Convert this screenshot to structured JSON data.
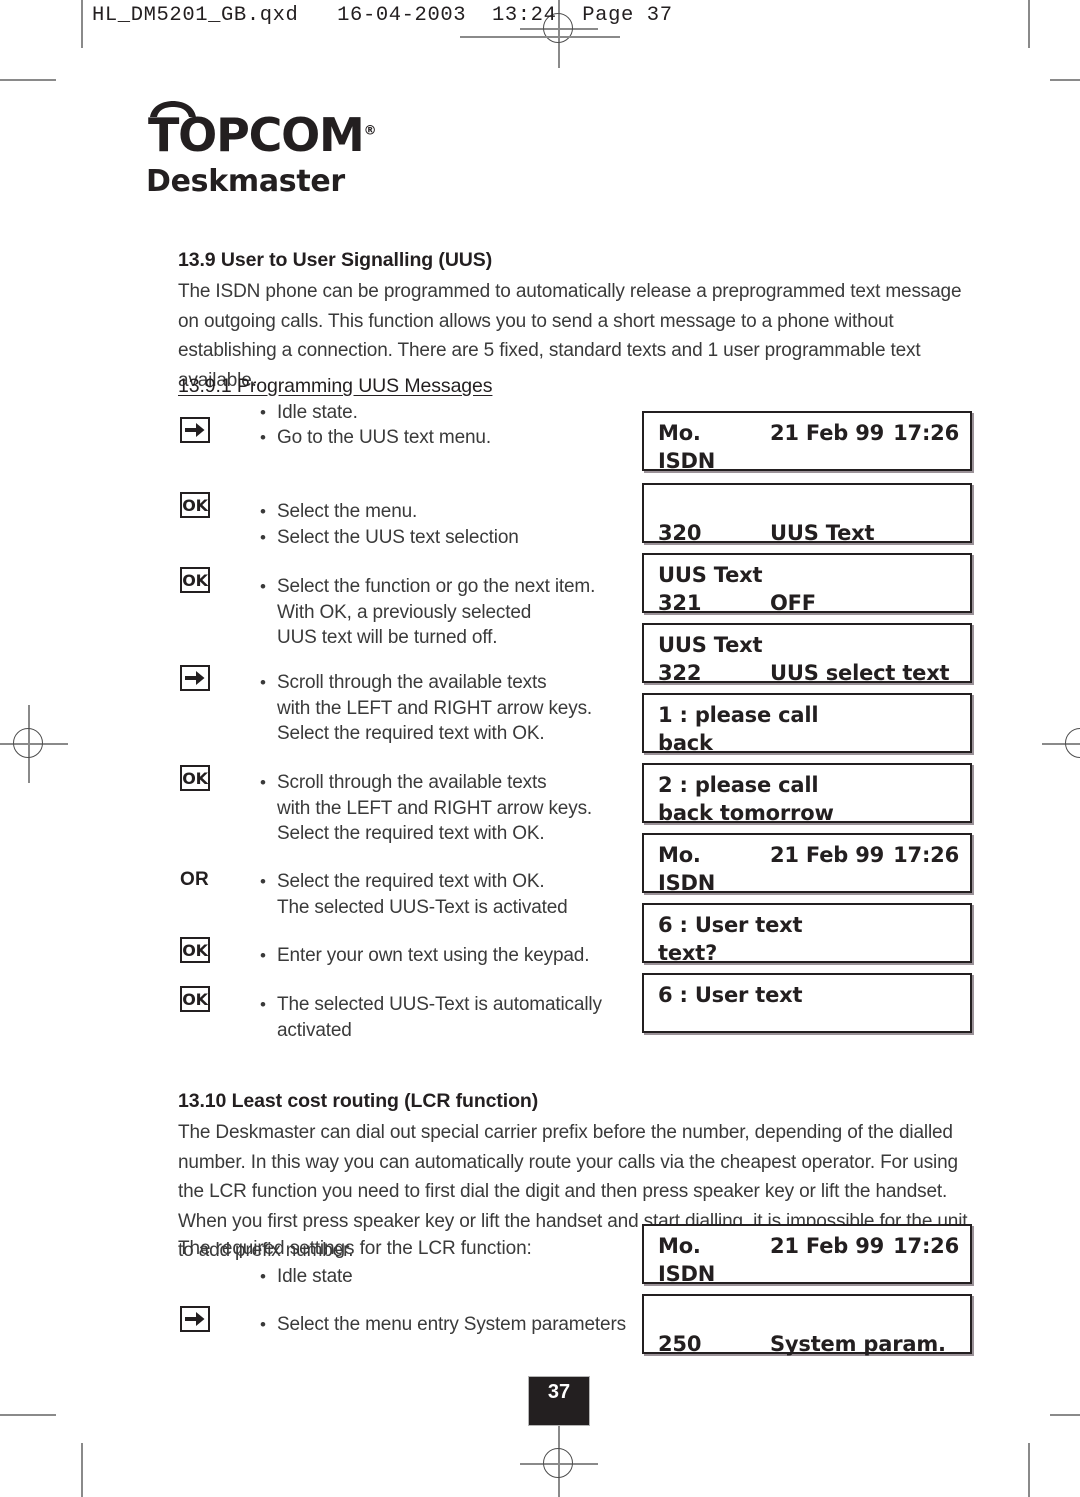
{
  "file_header": "HL_DM5201_GB.qxd   16-04-2003  13:24  Page 37",
  "logo": {
    "brand": "TOPCOM",
    "registered_mark": "®",
    "product": "Deskmaster"
  },
  "sections": {
    "uus": {
      "heading": "13.9 User to User Signalling (UUS)",
      "body": "The ISDN phone can be programmed to automatically release a preprogrammed text message on outgoing calls. This function allows you to send a short message to a phone without establishing a connection. There are 5 fixed, standard texts and 1 user programmable text available.",
      "subheading": "13.9.1 Programming UUS Messages"
    },
    "lcr": {
      "heading": "13.10 Least cost routing (LCR function)",
      "body": "The Deskmaster can dial out special carrier prefix before the number, depending of the dialled number. In this way you can automatically route your calls via the cheapest operator. For using the LCR function you need to first dial the digit and then press speaker key or lift the handset. When you first press speaker key or lift the handset and start dialling, it is impossible for the unit to add prefix number.",
      "settings_intro": "The required settings for the LCR function:"
    }
  },
  "uus_steps": [
    {
      "icon": "none",
      "lines": [
        {
          "bullet": true,
          "text": "Idle state."
        }
      ]
    },
    {
      "icon": "arrow-right",
      "lines": [
        {
          "bullet": true,
          "text": "Go to the UUS text menu."
        }
      ]
    },
    {
      "icon": "ok",
      "lines": [
        {
          "bullet": true,
          "text": "Select the menu."
        },
        {
          "bullet": true,
          "text": "Select the UUS text selection"
        }
      ]
    },
    {
      "icon": "ok",
      "lines": [
        {
          "bullet": true,
          "text": "Select the function or go the next item."
        },
        {
          "bullet": false,
          "text": "With OK, a previously selected"
        },
        {
          "bullet": false,
          "text": "UUS text will be turned off."
        }
      ]
    },
    {
      "icon": "arrow-right",
      "lines": [
        {
          "bullet": true,
          "text": "Scroll through the available texts"
        },
        {
          "bullet": false,
          "text": "with the LEFT and RIGHT arrow keys."
        },
        {
          "bullet": false,
          "text": "Select the required text with OK."
        }
      ]
    },
    {
      "icon": "ok",
      "lines": [
        {
          "bullet": true,
          "text": "Scroll through the available texts"
        },
        {
          "bullet": false,
          "text": "with the LEFT and RIGHT arrow keys."
        },
        {
          "bullet": false,
          "text": "Select the required text with OK."
        }
      ]
    },
    {
      "icon": "or",
      "icon_label": "OR",
      "lines": [
        {
          "bullet": true,
          "text": "Select the required text with OK."
        },
        {
          "bullet": false,
          "text": "The selected UUS-Text is activated"
        }
      ]
    },
    {
      "icon": "ok",
      "lines": [
        {
          "bullet": true,
          "text": "Enter your own text using the keypad."
        }
      ]
    },
    {
      "icon": "ok",
      "lines": [
        {
          "bullet": true,
          "text": "The selected UUS-Text is automatically"
        },
        {
          "bullet": false,
          "text": "activated"
        }
      ]
    }
  ],
  "lcr_steps": [
    {
      "icon": "none",
      "lines": [
        {
          "bullet": true,
          "text": "Idle state"
        }
      ]
    },
    {
      "icon": "arrow-right",
      "lines": [
        {
          "bullet": true,
          "text": "Select the menu entry System parameters"
        }
      ]
    }
  ],
  "uus_displays": [
    {
      "layout": "three",
      "line1": {
        "c1": "Mo.",
        "c2": "21 Feb 99",
        "c3": "17:26"
      },
      "line2": {
        "full": "ISDN"
      }
    },
    {
      "layout": "code",
      "line1": {
        "full": ""
      },
      "line2": {
        "c1": "320",
        "c2": "UUS Text"
      }
    },
    {
      "layout": "code",
      "line1": {
        "full": "UUS Text"
      },
      "line2": {
        "c1": "321",
        "c2": "OFF"
      }
    },
    {
      "layout": "code",
      "line1": {
        "full": "UUS Text"
      },
      "line2": {
        "c1": "322",
        "c2": "UUS select text"
      }
    },
    {
      "layout": "plain",
      "line1": {
        "full": "1 : please call"
      },
      "line2": {
        "full": "back"
      }
    },
    {
      "layout": "plain",
      "line1": {
        "full": "2 : please call"
      },
      "line2": {
        "full": "back tomorrow"
      }
    },
    {
      "layout": "three",
      "line1": {
        "c1": "Mo.",
        "c2": "21 Feb 99",
        "c3": "17:26"
      },
      "line2": {
        "full": "ISDN"
      }
    },
    {
      "layout": "plain",
      "line1": {
        "full": "6 : User text"
      },
      "line2": {
        "full": "text?"
      }
    },
    {
      "layout": "plain",
      "line1": {
        "full": "6 : User text"
      },
      "line2": {
        "full": ""
      }
    }
  ],
  "lcr_displays": [
    {
      "layout": "three",
      "line1": {
        "c1": "Mo.",
        "c2": "21 Feb 99",
        "c3": "17:26"
      },
      "line2": {
        "full": "ISDN"
      }
    },
    {
      "layout": "code",
      "line1": {
        "full": ""
      },
      "line2": {
        "c1": "250",
        "c2": "System param."
      }
    }
  ],
  "page_number": "37",
  "colors": {
    "ink": "#231f20",
    "body_text": "#3a3a3a",
    "crop_mark": "#8a8a8a",
    "lcd_shadow": "#9b9298"
  }
}
